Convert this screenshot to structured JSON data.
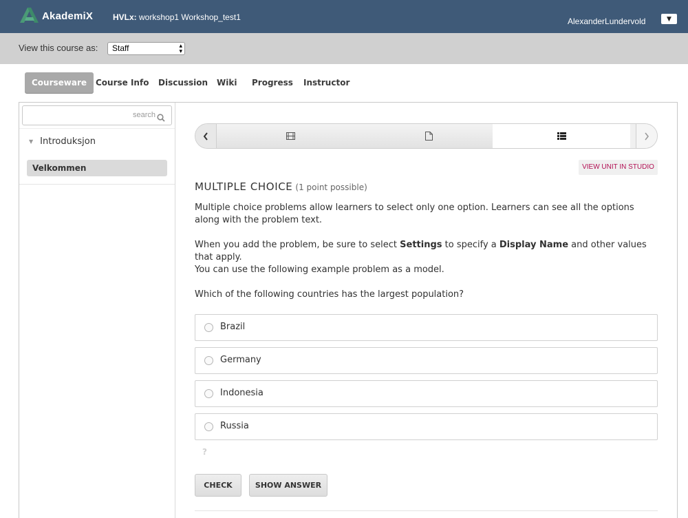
{
  "header": {
    "logo_text": "AkademiX",
    "course_org": "HVLx:",
    "course_name": " workshop1 Workshop_test1",
    "username": "AlexanderLundervold"
  },
  "view_as": {
    "label": "View this course as:",
    "selected": "Staff"
  },
  "tabs": [
    {
      "label": "Courseware",
      "active": true
    },
    {
      "label": "Course Info"
    },
    {
      "label": "Discussion"
    },
    {
      "label": "Wiki"
    },
    {
      "label": "Progress"
    },
    {
      "label": "Instructor"
    }
  ],
  "sidebar": {
    "search_placeholder": "search",
    "chapter": "Introduksjon",
    "section": "Velkommen"
  },
  "sequence": {
    "units": [
      "video-icon",
      "document-icon",
      "list-icon"
    ],
    "active_index": 2
  },
  "studio_button": "VIEW UNIT IN STUDIO",
  "problem": {
    "title": "MULTIPLE CHOICE",
    "points": "(1 point possible)",
    "intro": "Multiple choice problems allow learners to select only one option. Learners can see all the options along with the problem text.",
    "settings_pre": "When you add the problem, be sure to select ",
    "settings_b1": "Settings",
    "settings_mid": " to specify a ",
    "settings_b2": "Display Name",
    "settings_post": " and other values that apply.",
    "model": "You can use the following example problem as a model.",
    "question": "Which of the following countries has the largest population?",
    "choices": [
      "Brazil",
      "Germany",
      "Indonesia",
      "Russia"
    ],
    "hint_glyph": "?",
    "check_label": "CHECK",
    "show_answer_label": "SHOW ANSWER"
  },
  "colors": {
    "header_bg": "#3f5a78",
    "viewbar_bg": "#d0d0d0",
    "active_tab_bg": "#a9a9a9",
    "studio_text": "#b20f53",
    "logo_green": "#4a9a76"
  }
}
